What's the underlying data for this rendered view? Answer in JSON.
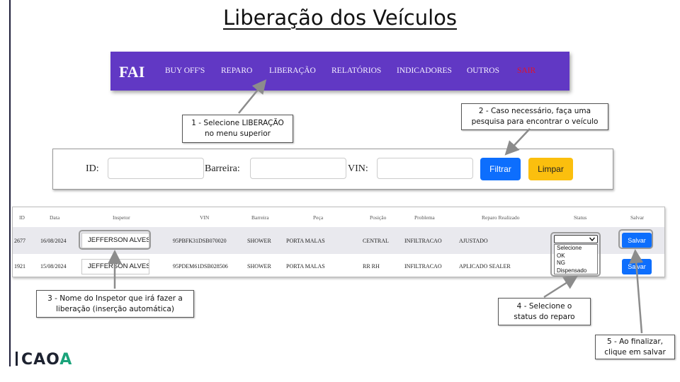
{
  "title": "Liberação dos Veículos",
  "nav": {
    "brand": "FAI",
    "items": [
      "BUY OFF'S",
      "REPARO",
      "LIBERAÇÃO",
      "RELATÓRIOS",
      "INDICADORES",
      "OUTROS",
      "SAIR"
    ]
  },
  "callouts": {
    "c1_line1": "1 - Selecione LIBERAÇÃO",
    "c1_line2": "no menu superior",
    "c2_line1": "2 - Caso necessário, faça uma",
    "c2_line2": "pesquisa para encontrar o veículo",
    "c3_line1": "3 - Nome do Inspetor que irá fazer a",
    "c3_line2": "liberação (inserção automática)",
    "c4_line1": "4 - Selecione o",
    "c4_line2": "status do reparo",
    "c5_line1": "5 - Ao finalizar,",
    "c5_line2": "clique em salvar"
  },
  "filter": {
    "id_label": "ID:",
    "barreira_label": "Barreira:",
    "vin_label": "VIN:",
    "filtrar_label": "Filtrar",
    "limpar_label": "Limpar"
  },
  "table": {
    "headers": [
      "ID",
      "Data",
      "Inspetor",
      "VIN",
      "Barreira",
      "Peça",
      "Posição",
      "Problema",
      "Reparo Realizado",
      "Status",
      "Salvar"
    ],
    "rows": [
      {
        "id": "2677",
        "data": "16/08/2024",
        "inspetor": "JEFFERSON ALVES",
        "vin": "95PBFK31DSB070020",
        "barreira": "SHOWER",
        "peca": "PORTA MALAS",
        "posicao": "CENTRAL",
        "problema": "INFILTRACAO",
        "reparo": "AJUSTADO",
        "salvar": "Salvar"
      },
      {
        "id": "1921",
        "data": "15/08/2024",
        "inspetor": "JEFFERSON ALVES",
        "vin": "95PDEM61DSB028506",
        "barreira": "SHOWER",
        "peca": "PORTA MALAS",
        "posicao": "RR RH",
        "problema": "INFILTRACAO",
        "reparo": "APLICADO SEALER",
        "salvar": "Salvar"
      }
    ],
    "status_options": [
      "Selecione",
      "OK",
      "NG",
      "Dispensado"
    ]
  },
  "logo": {
    "text_a": "CA",
    "text_o": "O",
    "text_last": "A"
  },
  "colors": {
    "nav_bg": "#6138c4",
    "primary": "#0d6efd",
    "warning": "#fbbf0e",
    "sair": "#e0122b"
  }
}
